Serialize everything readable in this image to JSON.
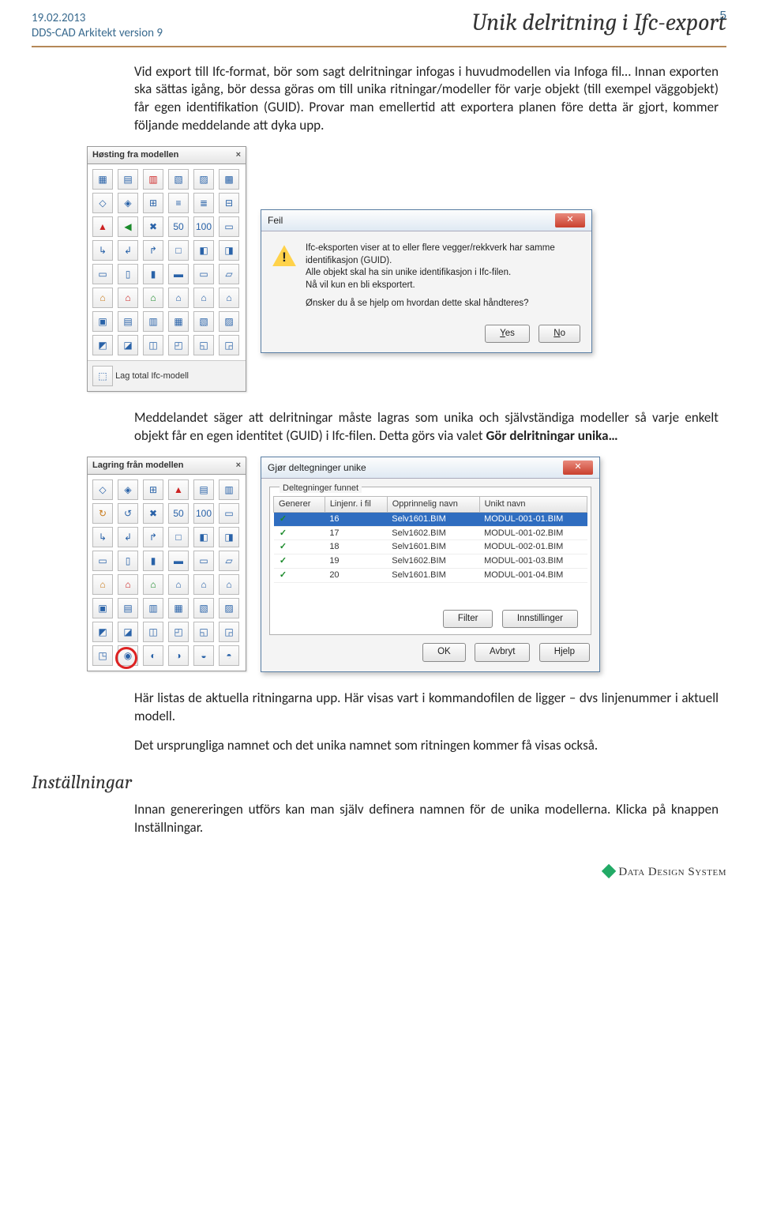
{
  "header": {
    "date": "19.02.2013",
    "product": "DDS-CAD Arkitekt version 9",
    "page_num": "5",
    "title": "Unik delritning i Ifc-export"
  },
  "para1": "Vid export till Ifc-format, bör som sagt delritningar infogas i huvudmodellen via Infoga fil… Innan exporten ska sättas igång, bör dessa göras om till unika ritningar/modeller för varje objekt (till exempel väggobjekt) får egen identifikation (GUID). Provar man emellertid att exportera planen före detta är gjort, kommer följande meddelande att dyka upp.",
  "toolbox1": {
    "title": "Høsting fra modellen",
    "footer": "Lag total Ifc-modell"
  },
  "feil": {
    "title": "Feil",
    "line1": "Ifc-eksporten viser at to eller flere vegger/rekkverk har samme identifikasjon (GUID).",
    "line2": "Alle objekt skal ha sin unike identifikasjon i Ifc-filen.",
    "line3": "Nå vil kun en bli eksportert.",
    "question": "Ønsker du å se hjelp om hvordan dette skal håndteres?",
    "yes": "Yes",
    "no": "No"
  },
  "para2_a": "Meddelandet säger att delritningar måste lagras som unika och självständiga modeller så varje enkelt objekt får en egen identitet (GUID) i Ifc-filen. Detta görs via valet ",
  "para2_b": "Gör delritningar unika…",
  "toolbox2": {
    "title": "Lagring från modellen"
  },
  "unik": {
    "title": "Gjør deltegninger unike",
    "group": "Deltegninger funnet",
    "columns": [
      "Generer",
      "Linjenr. i fil",
      "Opprinnelig navn",
      "Unikt navn"
    ],
    "rows": [
      {
        "gen": "✓",
        "ln": "16",
        "orig": "Selv1601.BIM",
        "unik": "MODUL-001-01.BIM",
        "sel": true
      },
      {
        "gen": "✓",
        "ln": "17",
        "orig": "Selv1602.BIM",
        "unik": "MODUL-001-02.BIM"
      },
      {
        "gen": "✓",
        "ln": "18",
        "orig": "Selv1601.BIM",
        "unik": "MODUL-002-01.BIM"
      },
      {
        "gen": "✓",
        "ln": "19",
        "orig": "Selv1602.BIM",
        "unik": "MODUL-001-03.BIM"
      },
      {
        "gen": "✓",
        "ln": "20",
        "orig": "Selv1601.BIM",
        "unik": "MODUL-001-04.BIM"
      }
    ],
    "btn_filter": "Filter",
    "btn_settings": "Innstillinger",
    "btn_ok": "OK",
    "btn_cancel": "Avbryt",
    "btn_help": "Hjelp"
  },
  "para3": "Här listas de aktuella ritningarna upp. Här visas vart i kommandofilen de ligger – dvs linjenummer i aktuell modell.",
  "para4": "Det ursprungliga namnet och det unika namnet som ritningen kommer få visas också.",
  "h2": "Inställningar",
  "para5": "Innan genereringen utförs kan man själv definera namnen för de unika modellerna. Klicka på knappen Inställningar.",
  "footer_logo": "Data Design System"
}
